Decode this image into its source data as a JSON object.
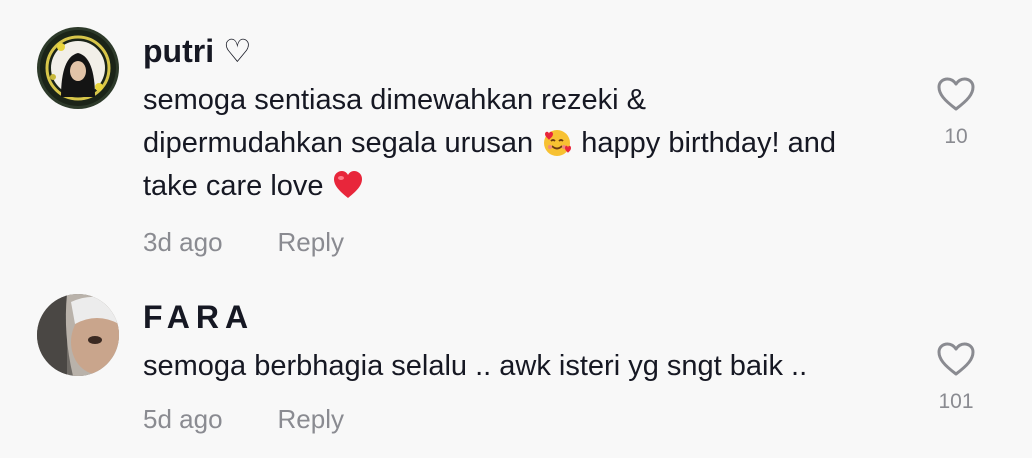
{
  "comments": [
    {
      "username": "putri ♡",
      "avatar_icon": "avatar-hijab-ring-icon",
      "text_lines": [
        "semoga sentiasa dimewahkan rezeki &",
        "dipermudahkan segala urusan",
        "happy birthday! and",
        "take care love"
      ],
      "emojis": [
        "smiling-face-with-hearts-icon",
        "red-heart-icon"
      ],
      "time": "3d ago",
      "reply_label": "Reply",
      "like_count": "10"
    },
    {
      "username": "FARA",
      "avatar_icon": "avatar-photo-icon",
      "text_lines": [
        "semoga berbhagia selalu .. awk isteri yg sngt baik .."
      ],
      "time": "5d ago",
      "reply_label": "Reply",
      "like_count": "101"
    }
  ],
  "colors": {
    "background": "#f8f8f8",
    "text": "#161823",
    "muted": "#8a8b91"
  }
}
